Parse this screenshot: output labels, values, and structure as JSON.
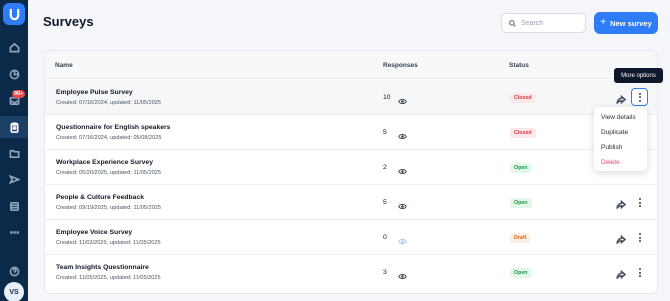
{
  "app": {
    "logo_icon": "app-logo-icon",
    "accent": "#2f7df6",
    "sidebar_bg": "#0b2a4a"
  },
  "sidebar": {
    "items": [
      {
        "name": "home",
        "icon": "home-icon"
      },
      {
        "name": "analytics",
        "icon": "pie-chart-icon"
      },
      {
        "name": "inbox",
        "icon": "inbox-icon",
        "badge": "99+"
      },
      {
        "name": "surveys",
        "icon": "clipboard-icon",
        "active": true
      },
      {
        "name": "folders",
        "icon": "folder-icon"
      },
      {
        "name": "send",
        "icon": "send-icon"
      },
      {
        "name": "database",
        "icon": "database-icon"
      },
      {
        "name": "more",
        "icon": "ellipsis-icon"
      },
      {
        "name": "help",
        "icon": "help-icon"
      }
    ],
    "avatar": "VS"
  },
  "header": {
    "title": "Surveys",
    "search_placeholder": "Search",
    "new_button": "New survey"
  },
  "table": {
    "columns": {
      "name": "Name",
      "responses": "Responses",
      "status": "Status"
    },
    "rows": [
      {
        "name": "Employee Pulse Survey",
        "meta": "Created: 07/16/2024, updated: 11/05/2025",
        "responses": "10",
        "status": "Closed",
        "status_color": "#d13b45"
      },
      {
        "name": "Questionnaire for English speakers",
        "meta": "Created: 07/16/2024, updated: 05/08/2025",
        "responses": "5",
        "status": "Closed",
        "status_color": "#d13b45"
      },
      {
        "name": "Workplace Experience Survey",
        "meta": "Created: 05/20/2025, updated: 11/05/2025",
        "responses": "2",
        "status": "Open",
        "status_color": "#23914d"
      },
      {
        "name": "People & Culture Feedback",
        "meta": "Created: 09/19/2025, updated: 11/05/2025",
        "responses": "5",
        "status": "Open",
        "status_color": "#23914d"
      },
      {
        "name": "Employee Voice Survey",
        "meta": "Created: 11/03/2025, updated: 11/05/2025",
        "responses": "0",
        "status": "Draft",
        "status_color": "#d96b1c"
      },
      {
        "name": "Team Insights Questionnaire",
        "meta": "Created: 11/05/2025, updated: 11/05/2025",
        "responses": "3",
        "status": "Open",
        "status_color": "#23914d"
      }
    ]
  },
  "tooltip": "More options",
  "menu": {
    "items": [
      {
        "label": "View details"
      },
      {
        "label": "Duplicate"
      },
      {
        "label": "Publish"
      },
      {
        "label": "Delete",
        "danger": true
      }
    ]
  }
}
